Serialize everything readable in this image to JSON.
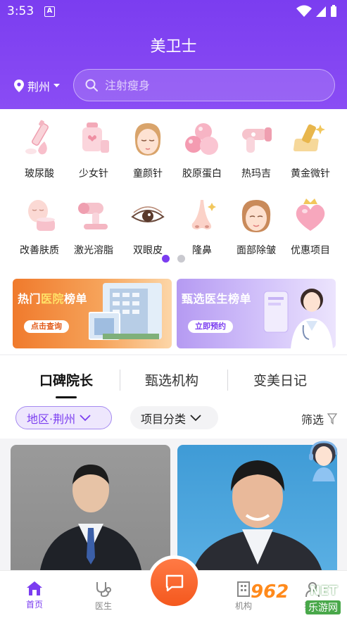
{
  "status_bar": {
    "time": "3:53",
    "a_label": "A"
  },
  "header": {
    "title": "美卫士",
    "location": "荆州",
    "search_placeholder": "注射瘦身"
  },
  "categories": [
    {
      "label": "玻尿酸",
      "icon": "hyaluronic-syringe-icon"
    },
    {
      "label": "少女针",
      "icon": "serum-bottles-icon"
    },
    {
      "label": "童颜针",
      "icon": "face-portrait-icon"
    },
    {
      "label": "胶原蛋白",
      "icon": "collagen-spheres-icon"
    },
    {
      "label": "热玛吉",
      "icon": "thermage-device-icon"
    },
    {
      "label": "黄金微针",
      "icon": "gold-microneedle-icon"
    },
    {
      "label": "改善肤质",
      "icon": "skin-care-face-icon"
    },
    {
      "label": "激光溶脂",
      "icon": "laser-device-icon"
    },
    {
      "label": "双眼皮",
      "icon": "eye-icon"
    },
    {
      "label": "隆鼻",
      "icon": "nose-icon"
    },
    {
      "label": "面部除皱",
      "icon": "face-wrinkle-icon"
    },
    {
      "label": "优惠项目",
      "icon": "heart-crown-icon"
    }
  ],
  "pager": {
    "count": 2,
    "active": 0
  },
  "banners": [
    {
      "title_a": "热门",
      "title_highlight": "医院",
      "title_b": "榜单",
      "button": "点击查询"
    },
    {
      "title": "甄选医生榜单",
      "button": "立即预约"
    }
  ],
  "tabs": [
    {
      "label": "口碑院长",
      "active": true
    },
    {
      "label": "甄选机构",
      "active": false
    },
    {
      "label": "变美日记",
      "active": false
    }
  ],
  "filters": {
    "region": "地区·荆州",
    "category": "项目分类",
    "filter": "筛选"
  },
  "bottom_nav": [
    {
      "label": "首页",
      "icon": "home-icon",
      "active": true
    },
    {
      "label": "医生",
      "icon": "stethoscope-icon",
      "active": false
    },
    {
      "label": "机构",
      "icon": "building-icon",
      "active": false
    },
    {
      "label": "我的",
      "icon": "profile-icon",
      "active": false
    }
  ],
  "watermark": {
    "number": "962",
    "suffix": "NET",
    "sub": "乐游网"
  },
  "colors": {
    "primary": "#7b3df0",
    "accent": "#f4581e",
    "banner_orange": "#f07a2c"
  }
}
